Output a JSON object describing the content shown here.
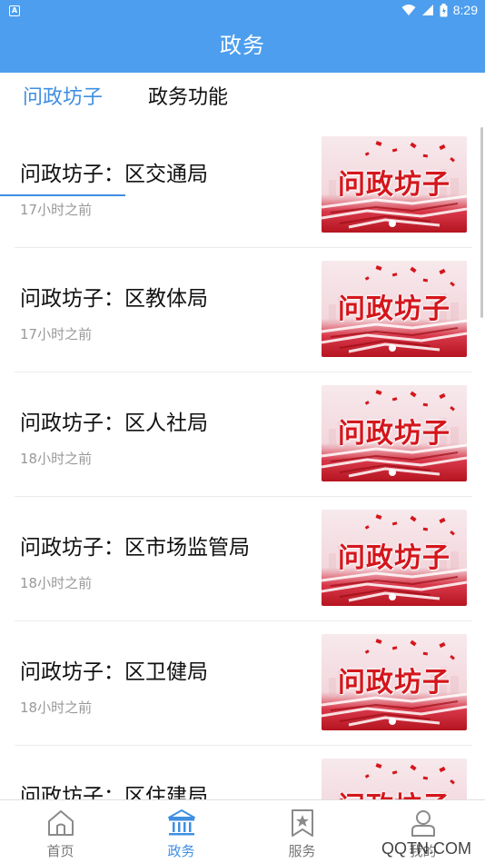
{
  "status_bar": {
    "time": "8:29"
  },
  "header": {
    "title": "政务"
  },
  "tabs": [
    {
      "label": "问政坊子",
      "active": true
    },
    {
      "label": "政务功能",
      "active": false
    }
  ],
  "articles": [
    {
      "title": "问政坊子：区交通局",
      "time": "17小时之前",
      "thumb_text": "问政坊子"
    },
    {
      "title": "问政坊子：区教体局",
      "time": "17小时之前",
      "thumb_text": "问政坊子"
    },
    {
      "title": "问政坊子：区人社局",
      "time": "18小时之前",
      "thumb_text": "问政坊子"
    },
    {
      "title": "问政坊子：区市场监管局",
      "time": "18小时之前",
      "thumb_text": "问政坊子"
    },
    {
      "title": "问政坊子：区卫健局",
      "time": "18小时之前",
      "thumb_text": "问政坊子"
    },
    {
      "title": "问政坊子：区住建局",
      "time": "",
      "thumb_text": "问政坊子"
    }
  ],
  "bottom_nav": [
    {
      "label": "首页",
      "icon": "home-icon",
      "active": false
    },
    {
      "label": "政务",
      "icon": "government-building-icon",
      "active": true
    },
    {
      "label": "服务",
      "icon": "bookmark-star-icon",
      "active": false
    },
    {
      "label": "我的",
      "icon": "user-icon",
      "active": false
    }
  ],
  "watermark": "QQTN.COM",
  "colors": {
    "primary": "#4d9eee",
    "active_text": "#3f8fe3",
    "muted_text": "#999999",
    "thumb_red": "#d4161c"
  }
}
